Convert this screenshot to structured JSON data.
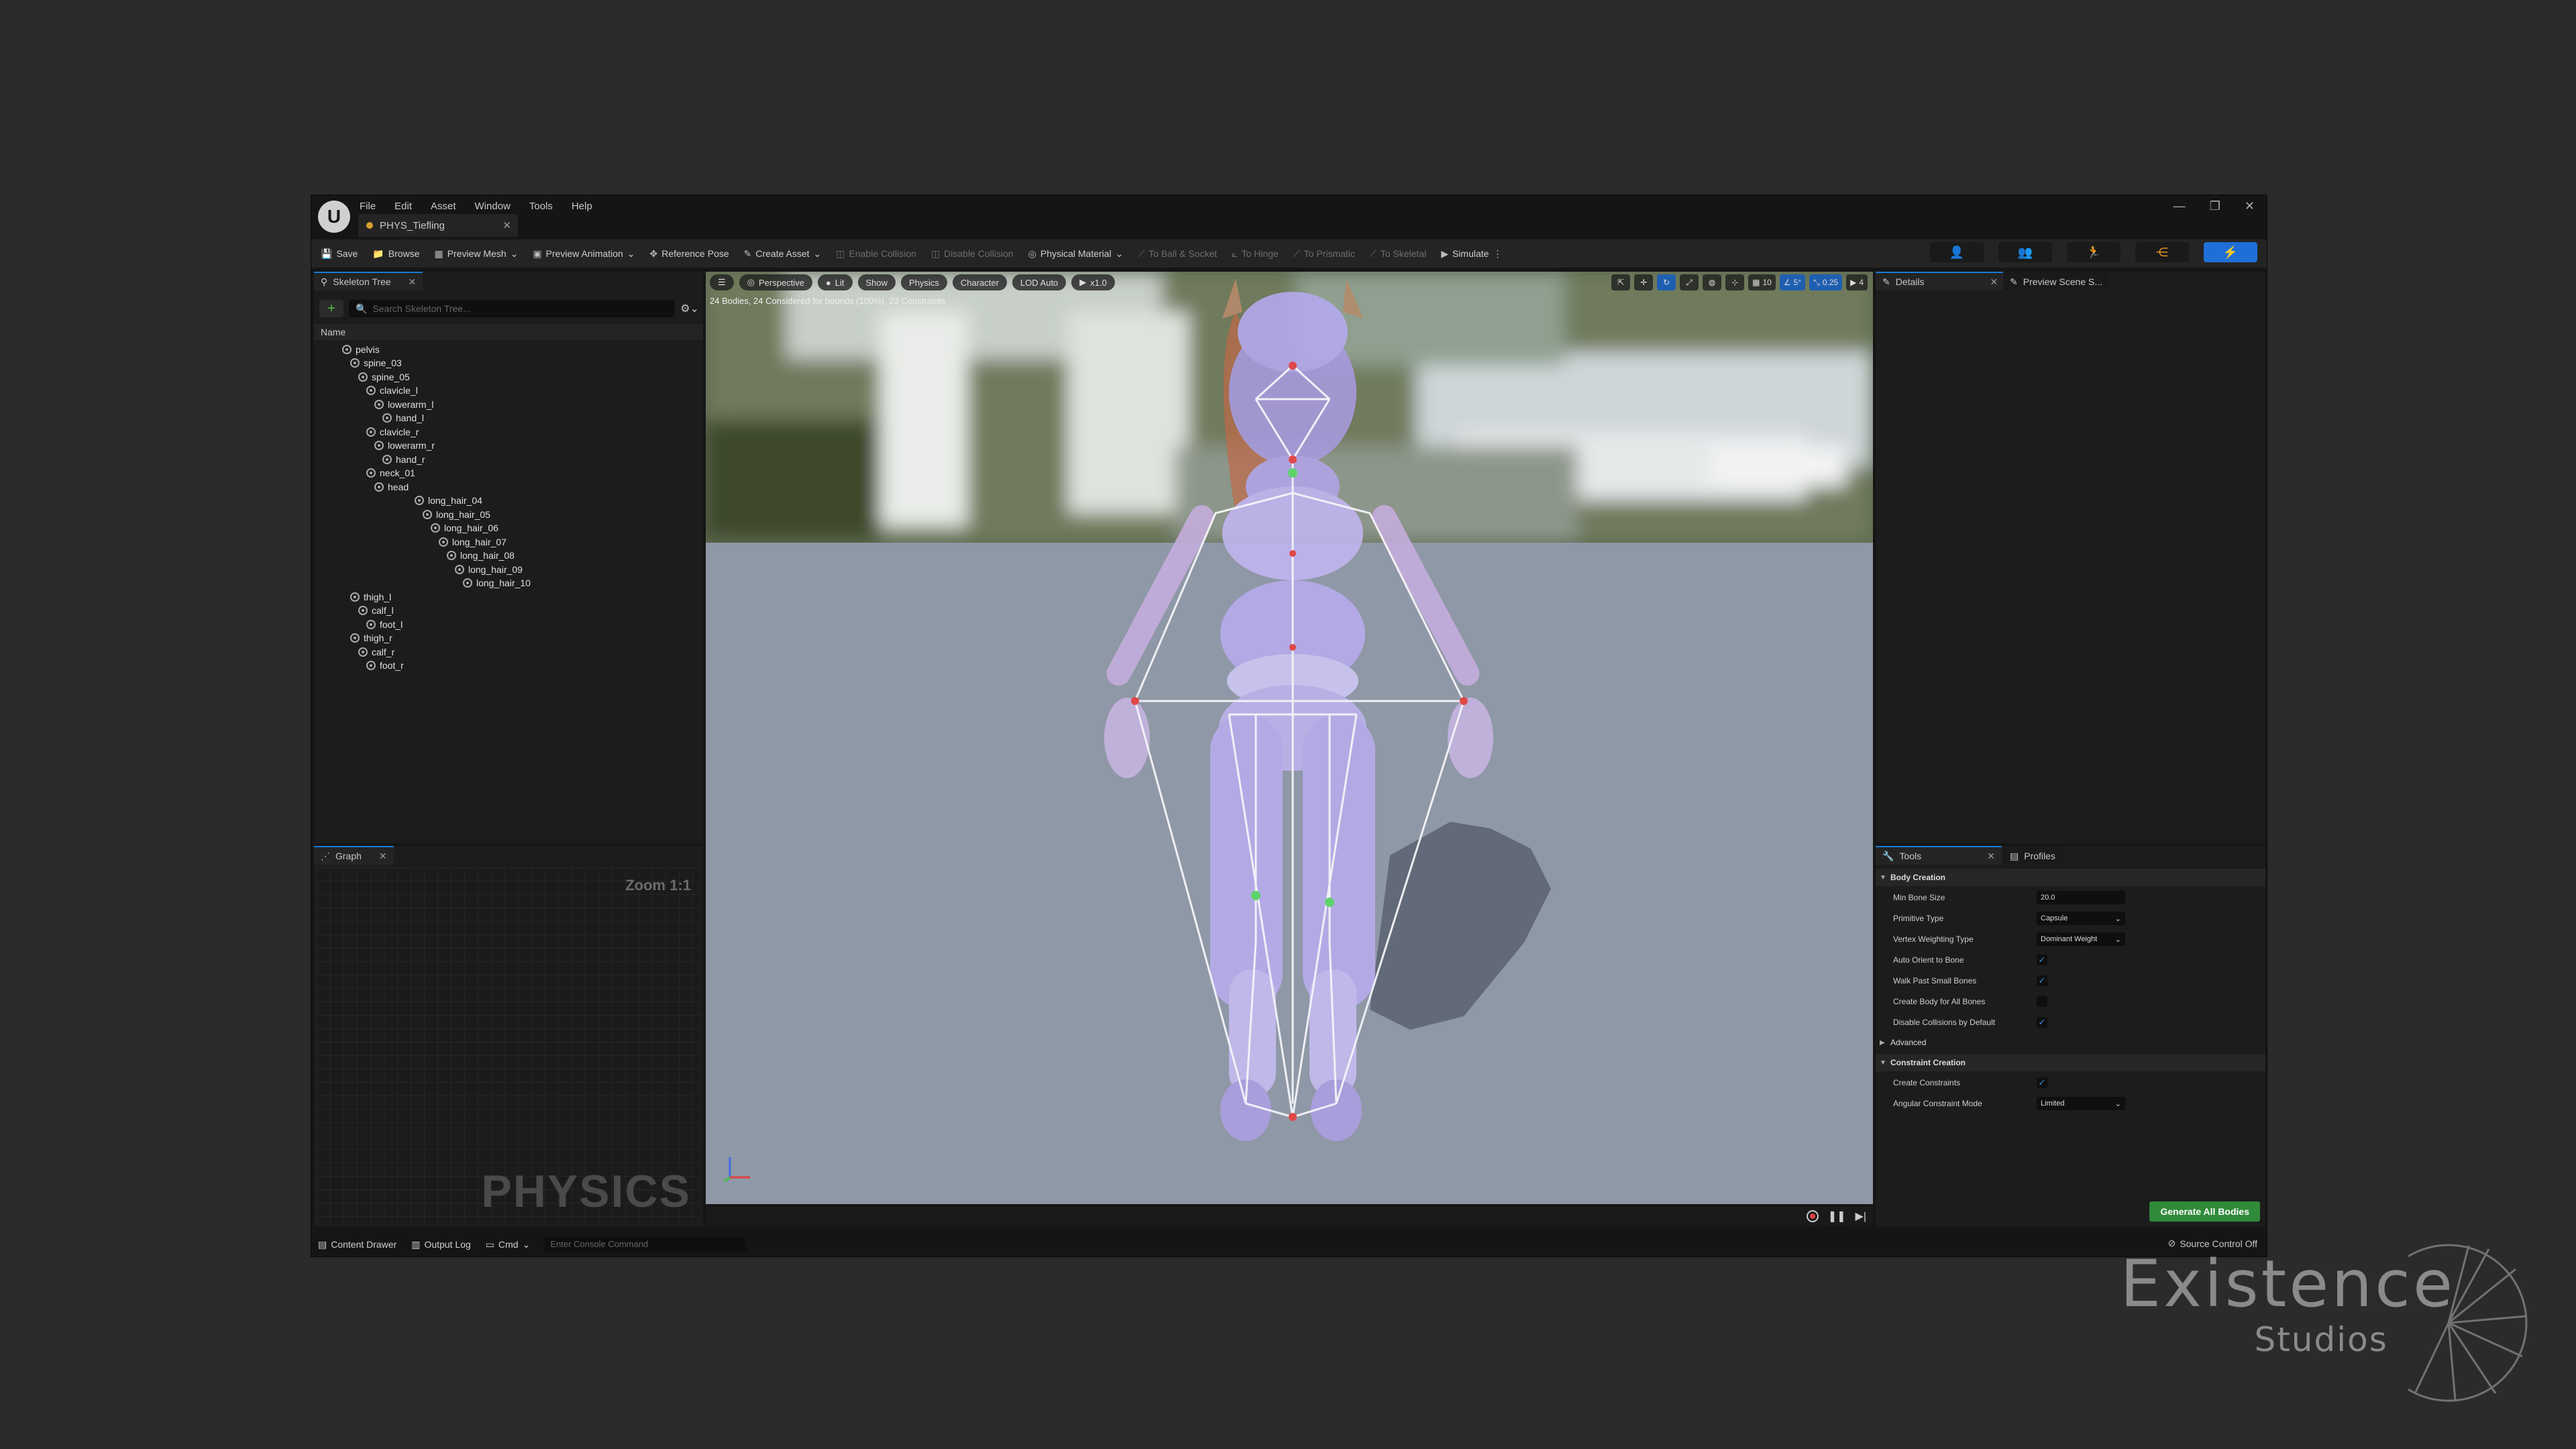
{
  "menu": [
    "File",
    "Edit",
    "Asset",
    "Window",
    "Tools",
    "Help"
  ],
  "doc_tab": "PHYS_Tiefling",
  "toolbar": {
    "save": "Save",
    "browse": "Browse",
    "preview_mesh": "Preview Mesh",
    "preview_animation": "Preview Animation",
    "reference_pose": "Reference Pose",
    "create_asset": "Create Asset",
    "enable_collision": "Enable Collision",
    "disable_collision": "Disable Collision",
    "physical_material": "Physical Material",
    "to_ball_socket": "To Ball & Socket",
    "to_hinge": "To Hinge",
    "to_prismatic": "To Prismatic",
    "to_skeletal": "To Skeletal",
    "simulate": "Simulate"
  },
  "skeleton": {
    "tab": "Skeleton Tree",
    "search_placeholder": "Search Skeleton Tree...",
    "col_name": "Name",
    "bones": [
      "pelvis",
      "spine_03",
      "spine_05",
      "clavicle_l",
      "lowerarm_l",
      "hand_l",
      "clavicle_r",
      "lowerarm_r",
      "hand_r",
      "neck_01",
      "head",
      "long_hair_04",
      "long_hair_05",
      "long_hair_06",
      "long_hair_07",
      "long_hair_08",
      "long_hair_09",
      "long_hair_10",
      "thigh_l",
      "calf_l",
      "foot_l",
      "thigh_r",
      "calf_r",
      "foot_r"
    ]
  },
  "graph": {
    "tab": "Graph",
    "zoom": "Zoom 1:1",
    "watermark": "PHYSICS"
  },
  "viewport": {
    "perspective": "Perspective",
    "lit": "Lit",
    "show": "Show",
    "physics": "Physics",
    "character": "Character",
    "lod": "LOD Auto",
    "speed": "x1.0",
    "stats": "24 Bodies, 24 Considered for bounds (100%), 23 Constraints",
    "grid": "10",
    "angle": "5°",
    "scale": "0.25",
    "cam": "4"
  },
  "details": {
    "tab": "Details",
    "tab2": "Preview Scene S..."
  },
  "tools": {
    "tab": "Tools",
    "tab2": "Profiles",
    "body_creation": "Body Creation",
    "min_bone_size_label": "Min Bone Size",
    "min_bone_size": "20.0",
    "primitive_type_label": "Primitive Type",
    "primitive_type": "Capsule",
    "vertex_weighting_label": "Vertex Weighting Type",
    "vertex_weighting": "Dominant Weight",
    "auto_orient_label": "Auto Orient to Bone",
    "walk_past_label": "Walk Past Small Bones",
    "create_body_label": "Create Body for All Bones",
    "disable_coll_label": "Disable Collisions by Default",
    "advanced": "Advanced",
    "constraint_creation": "Constraint Creation",
    "create_constraints_label": "Create Constraints",
    "angular_mode_label": "Angular Constraint Mode",
    "angular_mode": "Limited",
    "generate": "Generate All Bodies"
  },
  "status": {
    "content_drawer": "Content Drawer",
    "output_log": "Output Log",
    "cmd": "Cmd",
    "console_placeholder": "Enter Console Command",
    "source_control": "Source Control Off"
  },
  "watermark": {
    "line1": "Existence",
    "line2": "Studios"
  }
}
